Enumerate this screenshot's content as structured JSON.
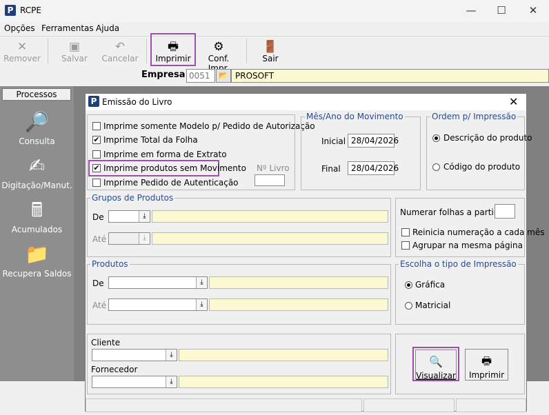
{
  "app": {
    "title": "RCPE",
    "icon_letter": "P"
  },
  "window_controls": {
    "minimize": "—",
    "maximize": "☐",
    "close": "✕"
  },
  "menu": [
    "Opções",
    "Ferramentas",
    "Ajuda"
  ],
  "toolbar": {
    "remover": "Remover",
    "salvar": "Salvar",
    "cancelar": "Cancelar",
    "imprimir": "Imprimir",
    "conf_impr": "Conf. Impr.",
    "sair": "Sair"
  },
  "empresa": {
    "label": "Empresa",
    "code": "0051",
    "name": "PROSOFT"
  },
  "sidebar": {
    "header": "Processos",
    "items": [
      {
        "label": "Consulta",
        "icon": "magnifier-monitor-icon"
      },
      {
        "label": "Digitação/Manut.",
        "icon": "hand-writing-icon"
      },
      {
        "label": "Acumulados",
        "icon": "calculator-icon"
      },
      {
        "label": "Recupera Saldos",
        "icon": "folder-recover-icon"
      }
    ]
  },
  "dialog": {
    "title": "Emissão do Livro",
    "icon_letter": "P",
    "options": [
      {
        "label": "Imprime somente Modelo p/ Pedido de Autorização",
        "checked": false
      },
      {
        "label": "Imprime Total da Folha",
        "checked": true
      },
      {
        "label": "Imprime em forma de Extrato",
        "checked": false
      },
      {
        "label": "Imprime produtos sem Movimento",
        "checked": true
      },
      {
        "label": "Imprime Pedido de Autenticação",
        "checked": false
      }
    ],
    "n_livro_label": "Nº Livro",
    "n_livro_value": "",
    "mes_ano": {
      "title": "Mês/Ano do Movimento",
      "inicial_label": "Inicial",
      "inicial_value": "28/04/2026",
      "final_label": "Final",
      "final_value": "28/04/2026"
    },
    "ordem": {
      "title": "Ordem p/ Impressão",
      "opt1": "Descrição do produto",
      "opt2": "Código do produto",
      "selected": "Descrição do produto"
    },
    "grupos": {
      "title": "Grupos de Produtos",
      "de": "De",
      "ate": "Até"
    },
    "numeracao": {
      "label": "Numerar folhas a partir de",
      "value": "",
      "reinicia": "Reinicia numeração a cada mês",
      "agrupar": "Agrupar na mesma página"
    },
    "produtos": {
      "title": "Produtos",
      "de": "De",
      "ate": "Até"
    },
    "tipo_impressao": {
      "title": "Escolha o tipo de Impressão",
      "opt1": "Gráfica",
      "opt2": "Matricial",
      "selected": "Gráfica"
    },
    "cliente_label": "Cliente",
    "fornecedor_label": "Fornecedor",
    "visualizar": "Visualizar",
    "imprimir": "Imprimir"
  }
}
